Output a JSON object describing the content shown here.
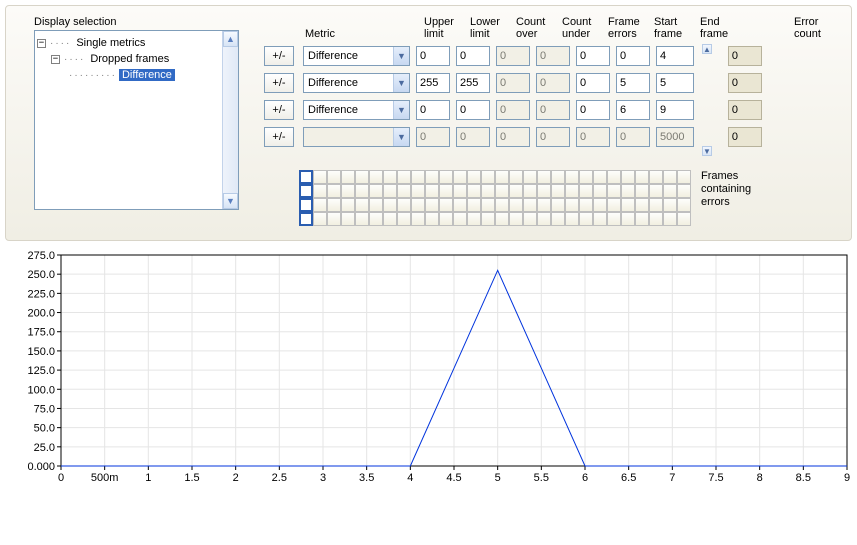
{
  "tree": {
    "label": "Display selection",
    "nodes": {
      "root": "Single metrics",
      "child1": "Dropped frames",
      "leaf": "Difference"
    }
  },
  "headers": {
    "metric": "Metric",
    "upper": "Upper\nlimit",
    "lower": "Lower\nlimit",
    "cover": "Count\nover",
    "cunder": "Count\nunder",
    "ferr": "Frame\nerrors",
    "sframe": "Start\nframe",
    "eframe": "End\nframe",
    "errcount": "Error\ncount"
  },
  "rules": [
    {
      "metric": "Difference",
      "upper": "0",
      "lower": "0",
      "cover": "0",
      "cunder": "0",
      "ferr": "0",
      "sframe": "0",
      "eframe": "4",
      "err": "0",
      "enabled": true
    },
    {
      "metric": "Difference",
      "upper": "255",
      "lower": "255",
      "cover": "0",
      "cunder": "0",
      "ferr": "0",
      "sframe": "5",
      "eframe": "5",
      "err": "0",
      "enabled": true
    },
    {
      "metric": "Difference",
      "upper": "0",
      "lower": "0",
      "cover": "0",
      "cunder": "0",
      "ferr": "0",
      "sframe": "6",
      "eframe": "9",
      "err": "0",
      "enabled": true
    },
    {
      "metric": "",
      "upper": "0",
      "lower": "0",
      "cover": "0",
      "cunder": "0",
      "ferr": "0",
      "sframe": "0",
      "eframe": "5000",
      "err": "0",
      "enabled": false
    }
  ],
  "plusminus_label": "+/-",
  "frames_label": "Frames\ncontaining\nerrors",
  "frame_grid": {
    "rows": 4,
    "cols": 28
  },
  "chart_data": {
    "type": "line",
    "x": [
      0,
      0.5,
      1,
      1.5,
      2,
      2.5,
      3,
      3.5,
      4,
      4.5,
      5,
      5.5,
      6,
      6.5,
      7,
      7.5,
      8,
      8.5,
      9
    ],
    "values": [
      0,
      0,
      0,
      0,
      0,
      0,
      0,
      0,
      0,
      127.5,
      255,
      127.5,
      0,
      0,
      0,
      0,
      0,
      0,
      0
    ],
    "xlabel": "",
    "ylabel": "",
    "xlim": [
      0,
      9
    ],
    "ylim": [
      0,
      275
    ],
    "xticks": [
      0,
      0.5,
      1,
      1.5,
      2,
      2.5,
      3,
      3.5,
      4,
      4.5,
      5,
      5.5,
      6,
      6.5,
      7,
      7.5,
      8,
      8.5,
      9
    ],
    "xticklabels": [
      "0",
      "500m",
      "1",
      "1.5",
      "2",
      "2.5",
      "3",
      "3.5",
      "4",
      "4.5",
      "5",
      "5.5",
      "6",
      "6.5",
      "7",
      "7.5",
      "8",
      "8.5",
      "9"
    ],
    "yticks": [
      0,
      25,
      50,
      75,
      100,
      125,
      150,
      175,
      200,
      225,
      250,
      275
    ],
    "yticklabels": [
      "0.000",
      "25.0",
      "50.0",
      "75.0",
      "100.0",
      "125.0",
      "150.0",
      "175.0",
      "200.0",
      "225.0",
      "250.0",
      "275.0"
    ]
  }
}
